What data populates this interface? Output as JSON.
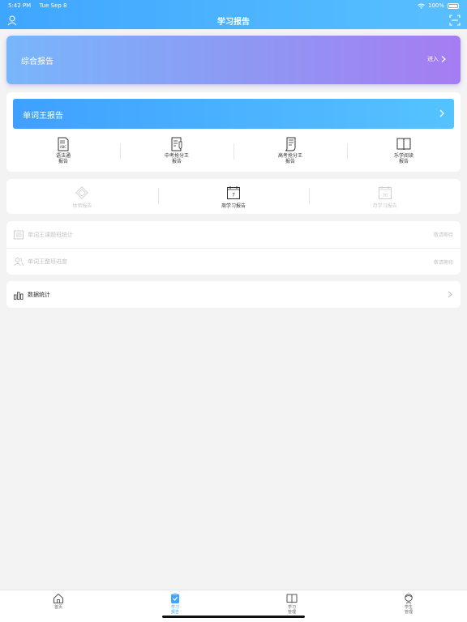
{
  "status": {
    "time": "5:42 PM",
    "date": "Tue Sep 8",
    "battery": "100%"
  },
  "navbar": {
    "title": "学习报告"
  },
  "summary": {
    "title": "综合报告",
    "enter_label": "进入"
  },
  "vocab": {
    "title": "单词王报告",
    "items": [
      {
        "line1": "语法通",
        "line2": "报告",
        "icon": "abc-doc-icon"
      },
      {
        "line1": "中考抢分王",
        "line2": "报告",
        "icon": "doc-pen-icon"
      },
      {
        "line1": "高考抢分王",
        "line2": "报告",
        "icon": "scroll-icon"
      },
      {
        "line1": "乐学阅读",
        "line2": "报告",
        "icon": "book-open-icon"
      }
    ]
  },
  "reports": {
    "items": [
      {
        "label": "体验报告",
        "icon": "diamond-icon",
        "enabled": false
      },
      {
        "label": "周学习报告",
        "icon": "calendar-7-icon",
        "calendar_num": "7",
        "enabled": true
      },
      {
        "label": "月学习报告",
        "icon": "calendar-30-icon",
        "calendar_num": "30",
        "enabled": false
      }
    ]
  },
  "stats": {
    "rows": [
      {
        "label": "单词王课题班统计",
        "right": "敬请期待",
        "icon": "list-icon"
      },
      {
        "label": "单词王整班进度",
        "right": "敬请期待",
        "icon": "users-icon"
      }
    ]
  },
  "data_stats": {
    "label": "数据统计",
    "icon": "bar-chart-icon"
  },
  "tabbar": {
    "tabs": [
      {
        "line1": "首页",
        "line2": "",
        "icon": "home-icon",
        "active": false
      },
      {
        "line1": "学习",
        "line2": "报告",
        "icon": "report-icon",
        "active": true
      },
      {
        "line1": "学习",
        "line2": "管理",
        "icon": "book-icon",
        "active": false
      },
      {
        "line1": "学生",
        "line2": "管理",
        "icon": "student-icon",
        "active": false
      }
    ]
  },
  "colors": {
    "brand": "#3fa6ff",
    "summary_start": "#78b6fb",
    "summary_end": "#a67cf2",
    "muted": "#c8c8c8"
  }
}
